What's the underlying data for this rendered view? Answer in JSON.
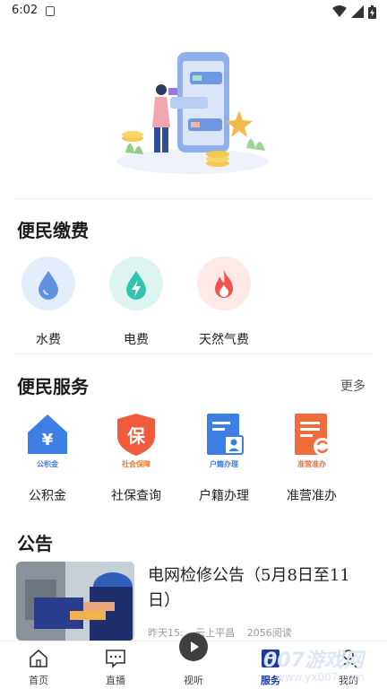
{
  "status_bar": {
    "time": "6:02"
  },
  "sections": {
    "payment": {
      "title": "便民缴费",
      "items": [
        {
          "label": "水费",
          "icon": "water-drop-icon",
          "bg": "#e4eefb",
          "color": "#5f93e0"
        },
        {
          "label": "电费",
          "icon": "lightning-icon",
          "bg": "#def4f1",
          "color": "#33c4b0"
        },
        {
          "label": "天然气费",
          "icon": "flame-icon",
          "bg": "#fde9e8",
          "color": "#f0544d"
        }
      ]
    },
    "services": {
      "title": "便民服务",
      "more_label": "更多",
      "items": [
        {
          "label": "公积金",
          "icon_text": "公积金",
          "icon": "housing-fund-icon",
          "color": "#3d7fe5"
        },
        {
          "label": "社保查询",
          "icon_text": "社会保障",
          "glyph": "保",
          "icon": "social-security-icon",
          "color": "#ef5a3a"
        },
        {
          "label": "户籍办理",
          "icon_text": "户籍办理",
          "icon": "household-register-icon",
          "color": "#3d7fe5"
        },
        {
          "label": "准营准办",
          "icon_text": "准营准办",
          "icon": "business-license-icon",
          "color": "#ef6d3a"
        }
      ]
    },
    "notice": {
      "title": "公告",
      "article": {
        "title": "电网检修公告（5月8日至11日）",
        "date": "昨天15:",
        "source": "云上平昌",
        "reads": "2056阅读"
      }
    }
  },
  "tab_bar": {
    "items": [
      {
        "label": "首页",
        "icon": "home-icon"
      },
      {
        "label": "直播",
        "icon": "live-chat-icon"
      },
      {
        "label": "视听",
        "icon": "play-icon"
      },
      {
        "label": "服务",
        "icon": "service-icon",
        "active": true
      },
      {
        "label": "我的",
        "icon": "profile-icon"
      }
    ]
  },
  "watermark": {
    "big": "007游戏网",
    "small": "www.yx007.com"
  },
  "colors": {
    "accent": "#1a3a9c",
    "text": "#1f1f1f",
    "muted": "#999999"
  }
}
